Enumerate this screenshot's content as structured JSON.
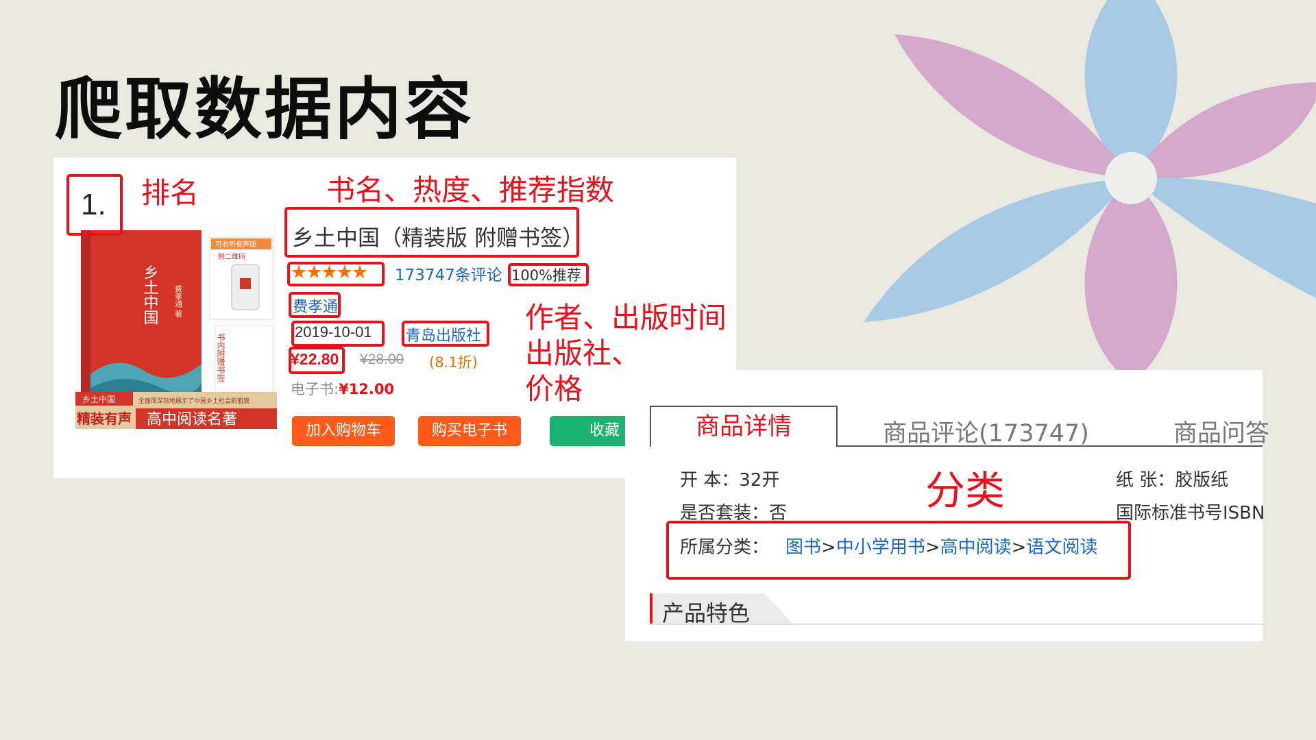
{
  "slide": {
    "title": "爬取数据内容"
  },
  "annotations": {
    "rank": "排名",
    "name_heat": "书名、热度、推荐指数",
    "author_date": "作者、出版时间",
    "publisher": "出版社、",
    "price": "价格",
    "category": "分类"
  },
  "product": {
    "rank": "1.",
    "cover": {
      "title": "乡土中国",
      "author_small": "费孝通 著",
      "badge_top": "可收听有声版",
      "badge_small": "附二维码",
      "badge_side": "书内附赠书签",
      "banner_tag": "乡土中国",
      "banner_slogan": "精装有声",
      "banner_text": "高中阅读名著",
      "banner_caption": "全面而深刻地展示了中国乡土社会的面貌"
    },
    "name": "乡土中国（精装版 附赠书签）",
    "stars": "★★★★★",
    "reviews": "173747条评论",
    "recommend": "100%推荐",
    "author": "费孝通",
    "pub_date": "2019-10-01",
    "publisher": "青岛出版社",
    "price": "¥22.80",
    "original_price": "¥28.00",
    "discount": "(8.1折)",
    "ebook_label": "电子书:",
    "ebook_price": "¥12.00",
    "buttons": {
      "cart": "加入购物车",
      "buy_ebook": "购买电子书",
      "favorite": "收藏"
    }
  },
  "detail": {
    "tabs": [
      "商品详情",
      "商品评论(173747)",
      "商品问答"
    ],
    "specs": {
      "format": "开 本：32开",
      "paper": "纸 张：胶版纸",
      "is_set": "是否套装：否",
      "isbn": "国际标准书号ISBN"
    },
    "category_label": "所属分类：",
    "category_trail": [
      "图书",
      "中小学用书",
      "高中阅读",
      "语文阅读"
    ],
    "section": "产品特色"
  },
  "colors": {
    "annotation_red": "#e8101a",
    "link_blue": "#1a66c4",
    "button_orange": "#ff5a1a",
    "button_green": "#18b16f",
    "petal_blue": "#a8c9e4",
    "petal_pink": "#d3a8ca"
  }
}
